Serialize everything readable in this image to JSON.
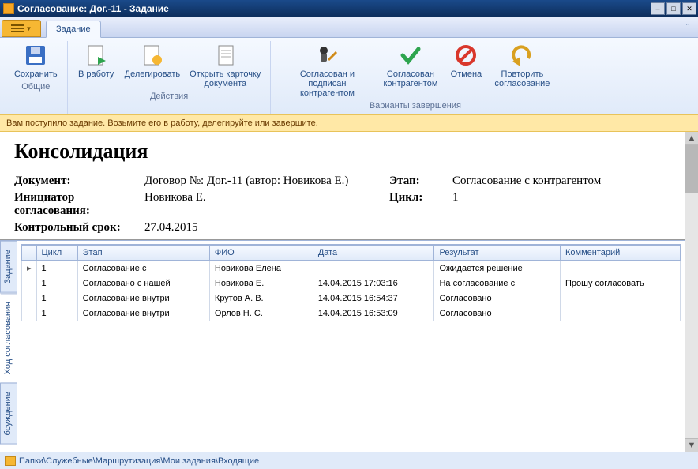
{
  "window": {
    "title": "Согласование: Дог.-11 - Задание"
  },
  "tabs": {
    "main": "Задание"
  },
  "ribbon": {
    "group_general": "Общие",
    "group_actions": "Действия",
    "group_results": "Варианты завершения",
    "save": "Сохранить",
    "start": "В работу",
    "delegate": "Делегировать",
    "open_card": "Открыть карточку\nдокумента",
    "agreed_signed": "Согласован и подписан\nконтрагентом",
    "agreed": "Согласован\nконтрагентом",
    "cancel": "Отмена",
    "repeat": "Повторить\nсогласование"
  },
  "notice": "Вам поступило задание. Возьмите его в работу, делегируйте или завершите.",
  "doc": {
    "heading": "Консолидация",
    "labels": {
      "document": "Документ:",
      "stage": "Этап:",
      "initiator": "Инициатор согласования:",
      "cycle": "Цикл:",
      "deadline": "Контрольный срок:"
    },
    "values": {
      "document": "Договор №: Дог.-11 (автор: Новикова Е.)",
      "stage": "Согласование с контрагентом",
      "initiator": "Новикова Е.",
      "cycle": "1",
      "deadline": "27.04.2015"
    }
  },
  "side_tabs": {
    "task": "Задание",
    "progress": "Ход согласования",
    "discussion": "бсуждение"
  },
  "grid": {
    "headers": {
      "cycle": "Цикл",
      "stage": "Этап",
      "fio": "ФИО",
      "date": "Дата",
      "result": "Результат",
      "comment": "Комментарий"
    },
    "rows": [
      {
        "cycle": "1",
        "stage": "Согласование с",
        "fio": "Новикова Елена",
        "date": "",
        "result": "Ожидается решение",
        "comment": ""
      },
      {
        "cycle": "1",
        "stage": "Согласовано с нашей",
        "fio": "Новикова Е.",
        "date": "14.04.2015 17:03:16",
        "result": "На согласование с",
        "comment": "Прошу согласовать"
      },
      {
        "cycle": "1",
        "stage": "Согласование внутри",
        "fio": "Крутов А. В.",
        "date": "14.04.2015 16:54:37",
        "result": "Согласовано",
        "comment": ""
      },
      {
        "cycle": "1",
        "stage": "Согласование внутри",
        "fio": "Орлов Н. С.",
        "date": "14.04.2015 16:53:09",
        "result": "Согласовано",
        "comment": ""
      }
    ]
  },
  "status_path": "Папки\\Служебные\\Маршрутизация\\Мои задания\\Входящие"
}
